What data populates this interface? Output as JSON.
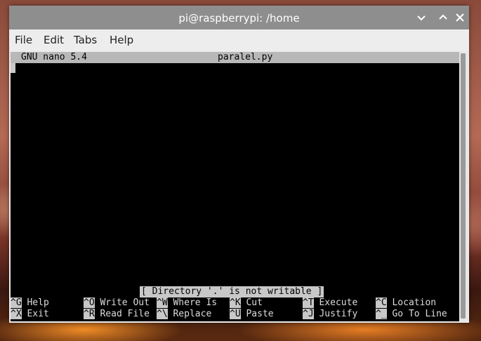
{
  "window": {
    "title": "pi@raspberrypi: /home"
  },
  "menu": [
    "File",
    "Edit",
    "Tabs",
    "Help"
  ],
  "nano": {
    "version": "GNU nano 5.4",
    "filename": "paralel.py",
    "status": "[ Directory '.' is not writable ]"
  },
  "shortcuts": [
    {
      "key": "^G",
      "label": "Help"
    },
    {
      "key": "^O",
      "label": "Write Out"
    },
    {
      "key": "^W",
      "label": "Where Is"
    },
    {
      "key": "^K",
      "label": "Cut"
    },
    {
      "key": "^T",
      "label": "Execute"
    },
    {
      "key": "^C",
      "label": "Location"
    },
    {
      "key": "^X",
      "label": "Exit"
    },
    {
      "key": "^R",
      "label": "Read File"
    },
    {
      "key": "^\\",
      "label": "Replace"
    },
    {
      "key": "^U",
      "label": "Paste"
    },
    {
      "key": "^J",
      "label": "Justify"
    },
    {
      "key": "^_",
      "label": "Go To Line"
    }
  ],
  "icons": [
    "chevron-down-icon",
    "minimize-icon",
    "maximize-icon",
    "close-icon"
  ]
}
